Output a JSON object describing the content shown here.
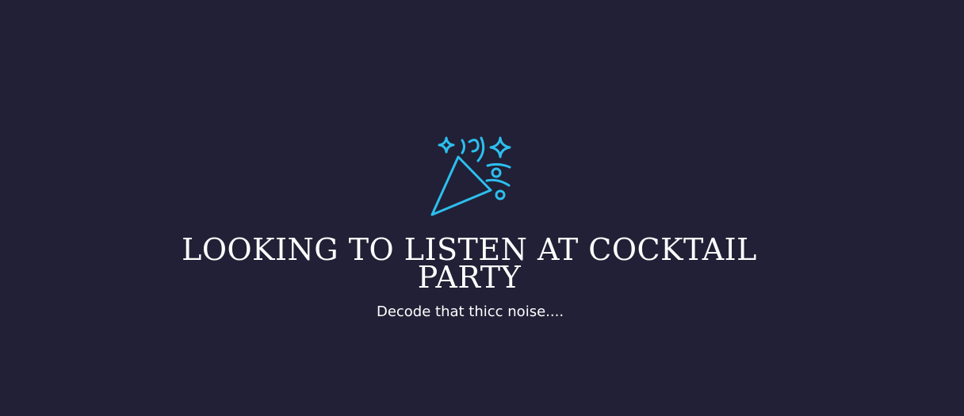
{
  "hero": {
    "icon": "party-popper-icon",
    "title": "LOOKING TO LISTEN AT COCKTAIL PARTY",
    "subtitle": "Decode that thicc noise...."
  },
  "colors": {
    "background": "#222036",
    "icon": "#2cbfef",
    "text": "#ffffff"
  }
}
